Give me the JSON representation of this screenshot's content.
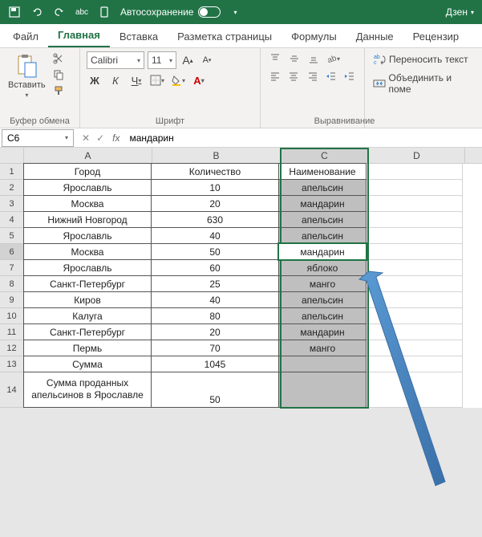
{
  "titlebar": {
    "autosave_label": "Автосохранение",
    "user": "Дзен"
  },
  "tabs": {
    "file": "Файл",
    "home": "Главная",
    "insert": "Вставка",
    "layout": "Разметка страницы",
    "formulas": "Формулы",
    "data": "Данные",
    "review": "Рецензир"
  },
  "ribbon": {
    "paste": "Вставить",
    "clipboard": "Буфер обмена",
    "font_name": "Calibri",
    "font_size": "11",
    "font": "Шрифт",
    "alignment": "Выравнивание",
    "wrap": "Переносить текст",
    "merge": "Объединить и поме"
  },
  "namebox": "C6",
  "formula": "мандарин",
  "columns": [
    "A",
    "B",
    "C",
    "D"
  ],
  "table": {
    "headers": {
      "a": "Город",
      "b": "Количество",
      "c": "Наименование"
    },
    "rows": [
      {
        "a": "Ярославль",
        "b": "10",
        "c": "апельсин"
      },
      {
        "a": "Москва",
        "b": "20",
        "c": "мандарин"
      },
      {
        "a": "Нижний Новгород",
        "b": "630",
        "c": "апельсин"
      },
      {
        "a": "Ярославль",
        "b": "40",
        "c": "апельсин"
      },
      {
        "a": "Москва",
        "b": "50",
        "c": "мандарин"
      },
      {
        "a": "Ярославль",
        "b": "60",
        "c": "яблоко"
      },
      {
        "a": "Санкт-Петербург",
        "b": "25",
        "c": "манго"
      },
      {
        "a": "Киров",
        "b": "40",
        "c": "апельсин"
      },
      {
        "a": "Калуга",
        "b": "80",
        "c": "апельсин"
      },
      {
        "a": "Санкт-Петербург",
        "b": "20",
        "c": "мандарин"
      },
      {
        "a": "Пермь",
        "b": "70",
        "c": "манго"
      },
      {
        "a": "Сумма",
        "b": "1045",
        "c": ""
      }
    ],
    "row14": {
      "a": "Сумма проданных апельсинов в Ярославле",
      "b": "50",
      "c": ""
    }
  }
}
